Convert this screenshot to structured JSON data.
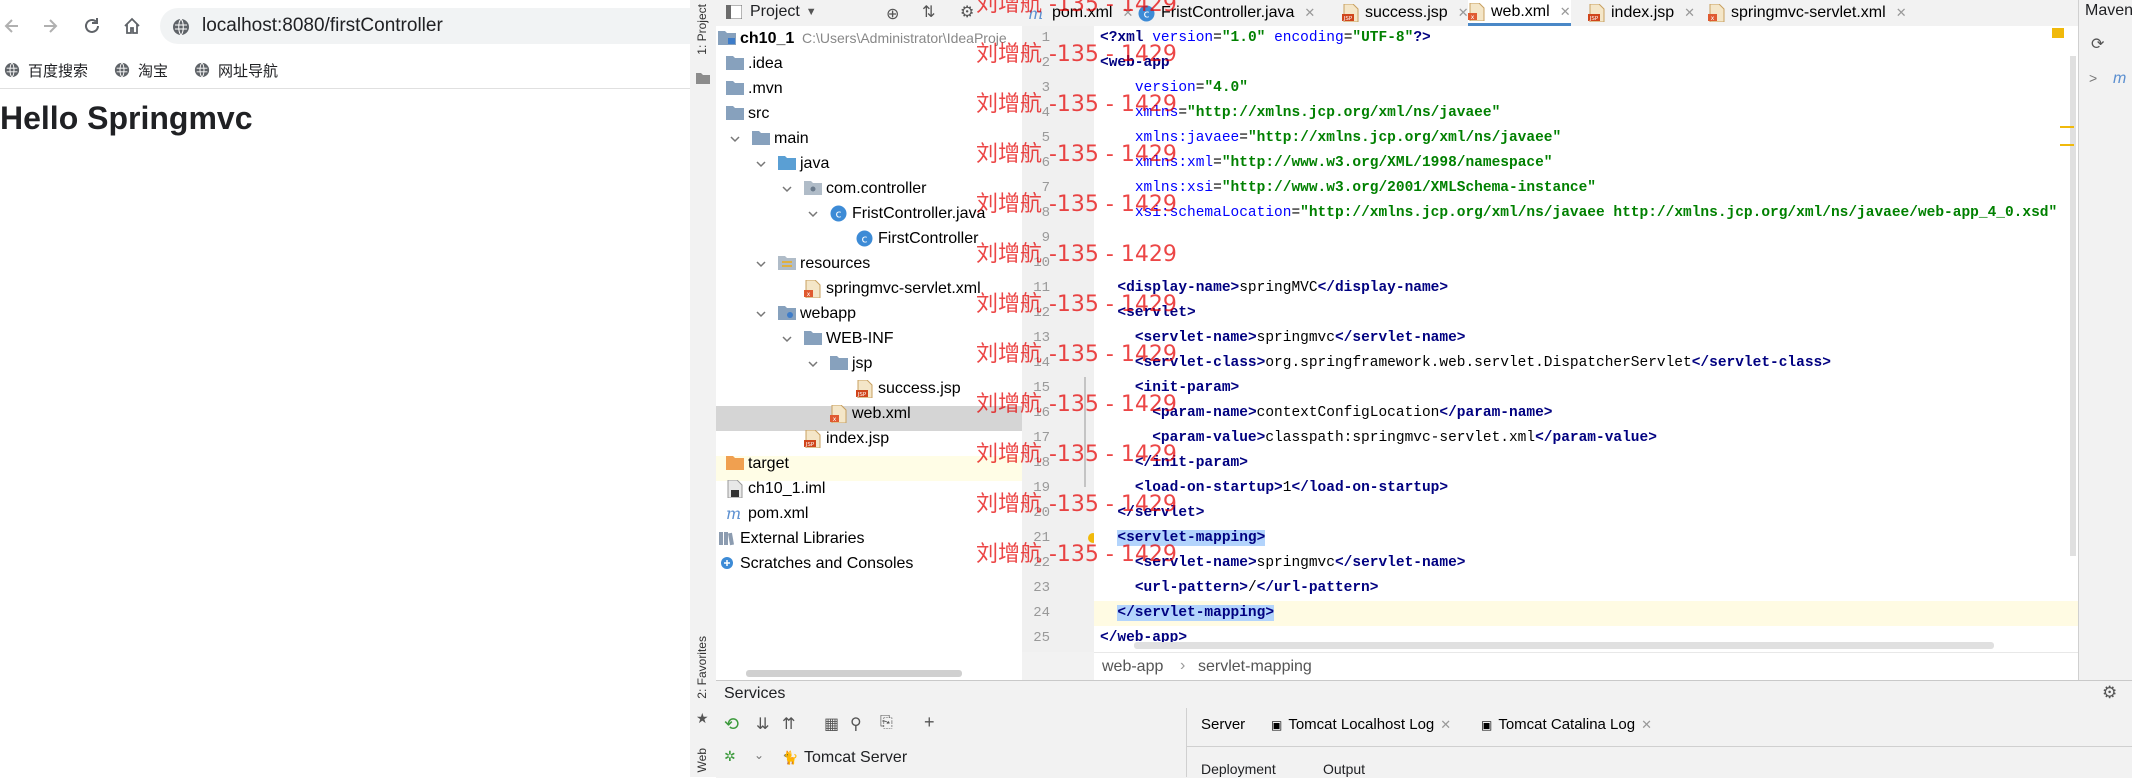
{
  "browser": {
    "url": "localhost:8080/firstController",
    "bookmarks": [
      "百度搜索",
      "淘宝",
      "网址导航"
    ],
    "page_heading": "Hello Springmvc"
  },
  "ide": {
    "left_strip": {
      "project_tab": "1: Project",
      "favorites_tab": "2: Favorites",
      "web_tab": "Web"
    },
    "project_view": {
      "dropdown_label": "Project",
      "tree": [
        {
          "label": "ch10_1",
          "suffix": "C:\\Users\\Administrator\\IdeaProje",
          "icon": "module-folder-icon"
        },
        {
          "label": ".idea",
          "icon": "folder-icon"
        },
        {
          "label": ".mvn",
          "icon": "folder-icon"
        },
        {
          "label": "src",
          "icon": "folder-icon"
        },
        {
          "label": "main",
          "icon": "folder-icon"
        },
        {
          "label": "java",
          "icon": "source-folder-icon"
        },
        {
          "label": "com.controller",
          "icon": "package-icon"
        },
        {
          "label": "FristController.java",
          "icon": "class-icon"
        },
        {
          "label": "FirstController",
          "icon": "class-icon"
        },
        {
          "label": "resources",
          "icon": "resources-folder-icon"
        },
        {
          "label": "springmvc-servlet.xml",
          "icon": "xml-file-icon"
        },
        {
          "label": "webapp",
          "icon": "web-folder-icon"
        },
        {
          "label": "WEB-INF",
          "icon": "folder-icon"
        },
        {
          "label": "jsp",
          "icon": "folder-icon"
        },
        {
          "label": "success.jsp",
          "icon": "jsp-file-icon"
        },
        {
          "label": "web.xml",
          "icon": "xml-file-icon"
        },
        {
          "label": "index.jsp",
          "icon": "jsp-file-icon"
        },
        {
          "label": "target",
          "icon": "excluded-folder-icon"
        },
        {
          "label": "ch10_1.iml",
          "icon": "iml-file-icon"
        },
        {
          "label": "pom.xml",
          "icon": "maven-file-icon"
        },
        {
          "label": "External Libraries",
          "icon": "libraries-icon"
        },
        {
          "label": "Scratches and Consoles",
          "icon": "scratches-icon"
        }
      ]
    },
    "editor_tabs": [
      {
        "label": "pom.xml",
        "icon": "maven-file-icon"
      },
      {
        "label": "FristController.java",
        "icon": "class-icon"
      },
      {
        "label": "success.jsp",
        "icon": "jsp-file-icon"
      },
      {
        "label": "web.xml",
        "icon": "xml-file-icon",
        "active": true
      },
      {
        "label": "index.jsp",
        "icon": "jsp-file-icon"
      },
      {
        "label": "springmvc-servlet.xml",
        "icon": "xml-file-icon"
      }
    ],
    "code_lines": [
      "<?xml version=\"1.0\" encoding=\"UTF-8\"?>",
      "<web-app",
      "    version=\"4.0\"",
      "    xmlns=\"http://xmlns.jcp.org/xml/ns/javaee\"",
      "    xmlns:javaee=\"http://xmlns.jcp.org/xml/ns/javaee\"",
      "    xmlns:xml=\"http://www.w3.org/XML/1998/namespace\"",
      "    xmlns:xsi=\"http://www.w3.org/2001/XMLSchema-instance\"",
      "    xsi:schemaLocation=\"http://xmlns.jcp.org/xml/ns/javaee http://xmlns.jcp.org/xml/ns/javaee/web-app_4_0.xsd\"",
      "",
      "",
      "  <display-name>springMVC</display-name>",
      "  <servlet>",
      "    <servlet-name>springmvc</servlet-name>",
      "    <servlet-class>org.springframework.web.servlet.DispatcherServlet</servlet-class>",
      "    <init-param>",
      "      <param-name>contextConfigLocation</param-name>",
      "      <param-value>classpath:springmvc-servlet.xml</param-value>",
      "    </init-param>",
      "    <load-on-startup>1</load-on-startup>",
      "  </servlet>",
      "  <servlet-mapping>",
      "    <servlet-name>springmvc</servlet-name>",
      "    <url-pattern>/</url-pattern>",
      "  </servlet-mapping>",
      "</web-app>"
    ],
    "breadcrumb": [
      "web-app",
      "servlet-mapping"
    ],
    "right_panel_title": "Maven",
    "services": {
      "title": "Services",
      "tree_item": "Tomcat Server",
      "tabs": [
        {
          "label": "Server",
          "closable": false
        },
        {
          "label": "Tomcat Localhost Log",
          "closable": true
        },
        {
          "label": "Tomcat Catalina Log",
          "closable": true
        }
      ],
      "subtabs": [
        "Deployment",
        "Output"
      ]
    },
    "watermark": "刘增航 -135 - 1429"
  },
  "colors": {
    "tag": "#000080",
    "attribute": "#0000ff",
    "string": "#008000",
    "watermark": "#e60000",
    "selection": "#b3d4fc"
  }
}
